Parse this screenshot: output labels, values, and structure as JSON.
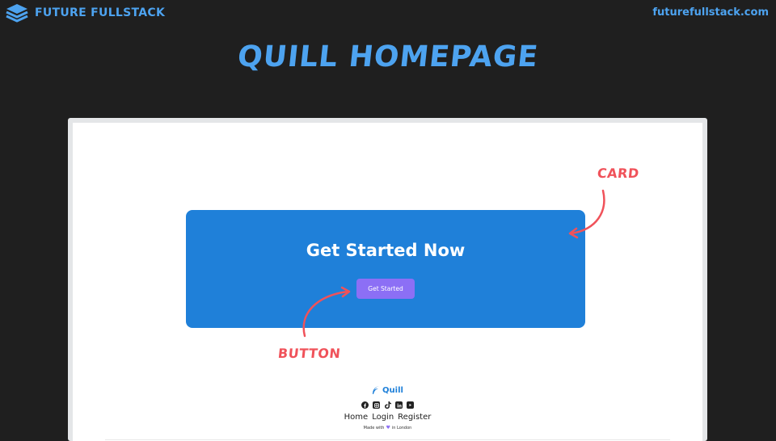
{
  "header": {
    "brand": "FUTURE FULLSTACK",
    "url": "futurefullstack.com",
    "title": "QUILL HOMEPAGE"
  },
  "card": {
    "heading": "Get Started Now",
    "button_label": "Get Started"
  },
  "annotations": {
    "card": "CARD",
    "button": "BUTTON"
  },
  "footer": {
    "logo_text": "Quill",
    "socials": [
      "facebook-icon",
      "instagram-icon",
      "tiktok-icon",
      "linkedin-icon",
      "youtube-icon"
    ],
    "nav": [
      "Home",
      "Login",
      "Register"
    ],
    "made_with_prefix": "Made with",
    "made_with_suffix": "in London"
  },
  "colors": {
    "background": "#1f1f1f",
    "brand_blue": "#4da3f0",
    "card_blue": "#1f80d9",
    "button_purple": "#8c6ff5",
    "annotation_red": "#f0525a"
  }
}
